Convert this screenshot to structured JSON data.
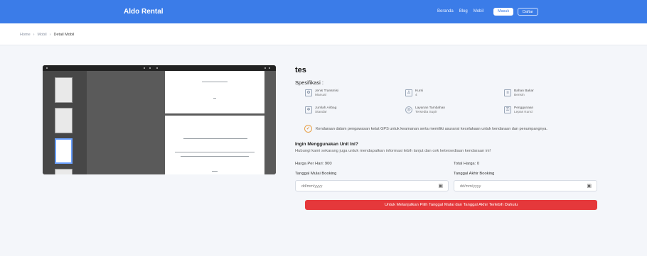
{
  "navbar": {
    "brand": "Aldo Rental",
    "links": [
      "Beranda",
      "Blog",
      "Mobil"
    ],
    "login_label": "Masuk",
    "register_label": "Daftar"
  },
  "breadcrumb": [
    "Home",
    "Mobil",
    "Detail Mobil"
  ],
  "product": {
    "title": "tes",
    "spec_heading": "Spesifikasi :",
    "specs": [
      {
        "icon": "transmission-icon",
        "label": "Jenis Transmisi",
        "value": "Manual"
      },
      {
        "icon": "seat-icon",
        "label": "Kursi",
        "value": "4"
      },
      {
        "icon": "fuel-icon",
        "label": "Bahan Bakar",
        "value": "Bensin"
      },
      {
        "icon": "ac-icon",
        "label": "Jumlah Airbag",
        "value": "Standar"
      },
      {
        "icon": "steering-icon",
        "label": "Layanan Tambahan",
        "value": "Tersedia Supir"
      },
      {
        "icon": "key-icon",
        "label": "Penggunaan",
        "value": "Lepas Kunci"
      }
    ],
    "notice": "Kendaraan dalam pengawasan ketat GPS untuk keamanan serta memiliki asuransi kecelakaan untuk kendaraan dan penumpangnya."
  },
  "booking": {
    "question": "Ingin Menggunakan Unit Ini?",
    "description": "Hubungi kami sekarang juga untuk mendapatkan informasi lebih lanjut dan cek ketersediaan kendaraan ini!",
    "price": "Harga Per Hari: 900",
    "total": "Total Harga: 0",
    "start_label": "Tanggal Mulai Booking",
    "end_label": "Tanggal Akhir Booking",
    "start_placeholder": "dd/mm/yyyy",
    "end_placeholder": "dd/mm/yyyy",
    "submit_label": "Untuk Melanjutkan Pilih Tanggal Mulai dan Tanggal Akhir Terlebih Dahulu"
  }
}
